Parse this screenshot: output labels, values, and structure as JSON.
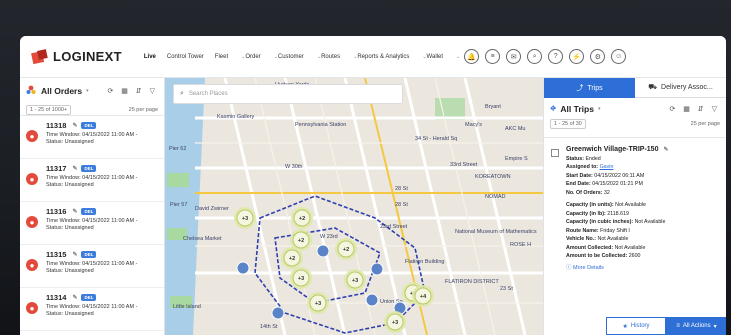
{
  "brand": {
    "name": "LOGINEXT",
    "accent": "#2d6fd6",
    "logo_red": "#e24b3b"
  },
  "nav": {
    "links": [
      {
        "label": "Live",
        "caret": false
      },
      {
        "label": "Control Tower",
        "caret": false
      },
      {
        "label": "Fleet",
        "caret": true
      },
      {
        "label": "Order",
        "caret": true
      },
      {
        "label": "Customer",
        "caret": true
      },
      {
        "label": "Routes",
        "caret": true
      },
      {
        "label": "Reports & Analytics",
        "caret": true
      },
      {
        "label": "Wallet",
        "caret": true
      }
    ],
    "icons": [
      "bell-icon",
      "list-icon",
      "chat-icon",
      "search-icon",
      "help-icon",
      "bolt-icon",
      "settings-icon",
      "user-icon"
    ]
  },
  "left_panel": {
    "title": "All Orders",
    "range": "1 - 25 of 1000+",
    "per_page": "25 per page",
    "orders": [
      {
        "id": "11318",
        "badge": "DEL",
        "time_window": "Time Window: 04/15/2022 11:00 AM -",
        "status": "Status: Unassigned"
      },
      {
        "id": "11317",
        "badge": "DEL",
        "time_window": "Time Window: 04/15/2022 11:00 AM -",
        "status": "Status: Unassigned"
      },
      {
        "id": "11316",
        "badge": "DEL",
        "time_window": "Time Window: 04/15/2022 11:00 AM -",
        "status": "Status: Unassigned"
      },
      {
        "id": "11315",
        "badge": "DEL",
        "time_window": "Time Window: 04/15/2022 11:00 AM -",
        "status": "Status: Unassigned"
      },
      {
        "id": "11314",
        "badge": "DEL",
        "time_window": "Time Window: 04/15/2022 11:00 AM -",
        "status": "Status: Unassigned"
      }
    ]
  },
  "map": {
    "search_placeholder": "Search Places",
    "labels": [
      "Hudson Yards",
      "34 St - Penn Station",
      "Kasmin Gallery",
      "Pennsylvania Station",
      "Macy's",
      "AKC Mu",
      "34 St - Herald Sq",
      "Empire S",
      "KOREATOWN",
      "33rd Street",
      "28 St",
      "NOMAD",
      "23rd Street",
      "National Museum of Mathematics",
      "ROSE H",
      "Flatiron Building",
      "FLATIRON DISTRICT",
      "23 St",
      "Chelsea Market",
      "Pier 57",
      "Little Island",
      "Pier 62",
      "David Zwirner",
      "14th St",
      "Bryant",
      "W 30th",
      "W 23rd",
      "28 St",
      "Union Sq"
    ],
    "clusters": [
      "+3",
      "+2",
      "+2",
      "+2",
      "+3",
      "+3",
      "+3",
      "+2",
      "+2",
      "+3",
      "+4",
      "+4"
    ]
  },
  "right_panel": {
    "tabs": [
      "Trips",
      "Delivery Assoc..."
    ],
    "title": "All Trips",
    "range": "1 - 25 of 30",
    "per_page": "25 per page",
    "trip": {
      "name": "Greenwich Village-TRIP-150",
      "lines": [
        {
          "k": "Status:",
          "v": "Ended"
        },
        {
          "k": "Assigned to:",
          "v": "Gavin",
          "link": true
        },
        {
          "k": "Start Date:",
          "v": "04/15/2022 06:11 AM"
        },
        {
          "k": "End Date:",
          "v": "04/15/2022 01:21 PM"
        },
        {
          "k": "No. Of Orders:",
          "v": "32"
        }
      ],
      "lines2": [
        {
          "k": "Capacity (in units):",
          "v": "Not Available"
        },
        {
          "k": "Capacity (in lb):",
          "v": "2118.619"
        },
        {
          "k": "Capacity (in cubic inches):",
          "v": "Not Available"
        },
        {
          "k": "Route Name:",
          "v": "Friday Shift I"
        },
        {
          "k": "Vehicle No.:",
          "v": "Not Available"
        },
        {
          "k": "Amount Collected:",
          "v": "Not Available"
        },
        {
          "k": "Amount to be Collected:",
          "v": "2600"
        }
      ],
      "more": "More Details"
    },
    "footer": {
      "history": "History",
      "actions": "All Actions"
    }
  }
}
